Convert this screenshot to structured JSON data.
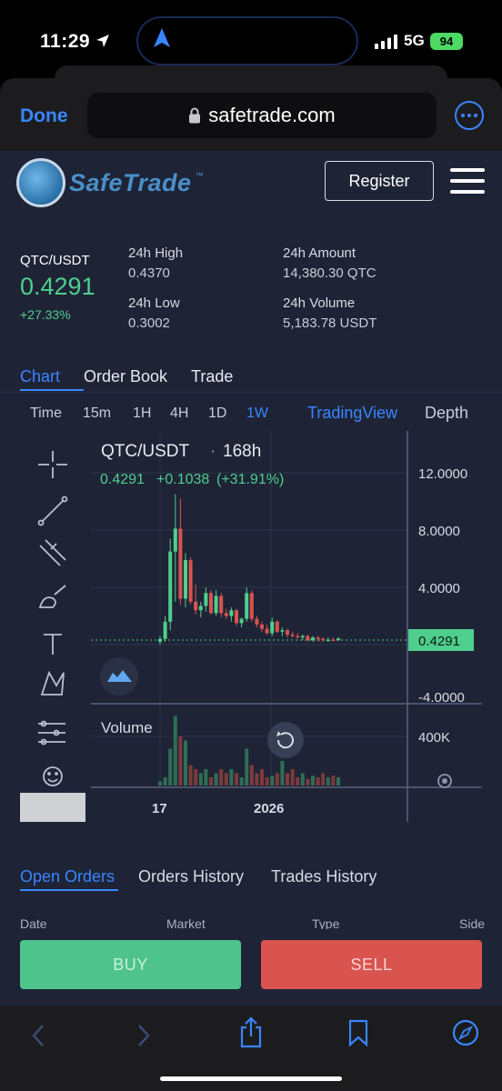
{
  "status_bar": {
    "time": "11:29",
    "network": "5G",
    "battery": "94"
  },
  "browser": {
    "done_label": "Done",
    "url": "safetrade.com"
  },
  "site": {
    "brand": "SafeTrade",
    "tm": "™",
    "register_label": "Register"
  },
  "ticker": {
    "pair": "QTC/USDT",
    "price": "0.4291",
    "change": "+27.33%",
    "high_label": "24h High",
    "high_value": "0.4370",
    "low_label": "24h Low",
    "low_value": "0.3002",
    "amount_label": "24h Amount",
    "amount_value": "14,380.30 QTC",
    "volume_label": "24h Volume",
    "volume_value": "5,183.78 USDT"
  },
  "tabs": {
    "chart": "Chart",
    "order_book": "Order Book",
    "trade": "Trade"
  },
  "intervals": [
    "Time",
    "15m",
    "1H",
    "4H",
    "1D",
    "1W"
  ],
  "chart_modes": {
    "tradingview": "TradingView",
    "depth": "Depth"
  },
  "colors": {
    "up": "#4fce8e",
    "down": "#d9534f",
    "accent": "#3a85ff",
    "bg": "#1e2436"
  },
  "chart_data": {
    "type": "candlestick",
    "title": "QTC/USDT",
    "interval": "168h",
    "last_line": {
      "close": "0.4291",
      "change": "+0.1038",
      "change_pct": "(+31.91%)"
    },
    "price_label": "0.4291",
    "y_ticks": [
      "12.0000",
      "8.0000",
      "4.0000",
      "-4.0000"
    ],
    "ylim": [
      -4,
      14.5
    ],
    "volume_label": "Volume",
    "volume_ticks": [
      "400K"
    ],
    "x_ticks": [
      "17",
      "2026"
    ],
    "candles": [
      {
        "o": 0.2,
        "h": 0.6,
        "l": 0.0,
        "c": 0.4
      },
      {
        "o": 0.4,
        "h": 2.0,
        "l": 0.2,
        "c": 1.6
      },
      {
        "o": 1.6,
        "h": 7.4,
        "l": 1.0,
        "c": 6.5
      },
      {
        "o": 6.5,
        "h": 10.5,
        "l": 3.0,
        "c": 8.1
      },
      {
        "o": 8.1,
        "h": 10.2,
        "l": 2.8,
        "c": 3.2
      },
      {
        "o": 3.2,
        "h": 6.4,
        "l": 2.6,
        "c": 5.9
      },
      {
        "o": 5.9,
        "h": 6.1,
        "l": 2.8,
        "c": 3.0
      },
      {
        "o": 3.0,
        "h": 4.2,
        "l": 2.1,
        "c": 2.4
      },
      {
        "o": 2.4,
        "h": 3.0,
        "l": 1.9,
        "c": 2.7
      },
      {
        "o": 2.7,
        "h": 4.0,
        "l": 2.3,
        "c": 3.6
      },
      {
        "o": 3.6,
        "h": 3.8,
        "l": 2.1,
        "c": 2.2
      },
      {
        "o": 2.2,
        "h": 3.8,
        "l": 2.0,
        "c": 3.4
      },
      {
        "o": 3.4,
        "h": 3.6,
        "l": 1.9,
        "c": 2.2
      },
      {
        "o": 2.2,
        "h": 2.5,
        "l": 1.8,
        "c": 2.0
      },
      {
        "o": 2.0,
        "h": 2.6,
        "l": 1.6,
        "c": 2.4
      },
      {
        "o": 2.4,
        "h": 2.5,
        "l": 1.3,
        "c": 1.5
      },
      {
        "o": 1.5,
        "h": 1.9,
        "l": 1.2,
        "c": 1.8
      },
      {
        "o": 1.8,
        "h": 4.0,
        "l": 1.6,
        "c": 3.6
      },
      {
        "o": 3.6,
        "h": 3.8,
        "l": 1.6,
        "c": 1.8
      },
      {
        "o": 1.8,
        "h": 2.0,
        "l": 1.2,
        "c": 1.4
      },
      {
        "o": 1.4,
        "h": 1.6,
        "l": 0.9,
        "c": 1.1
      },
      {
        "o": 1.1,
        "h": 1.4,
        "l": 0.7,
        "c": 0.8
      },
      {
        "o": 0.8,
        "h": 1.9,
        "l": 0.6,
        "c": 1.6
      },
      {
        "o": 1.6,
        "h": 1.7,
        "l": 0.8,
        "c": 0.9
      },
      {
        "o": 0.9,
        "h": 1.2,
        "l": 0.6,
        "c": 1.0
      },
      {
        "o": 1.0,
        "h": 1.1,
        "l": 0.5,
        "c": 0.7
      },
      {
        "o": 0.7,
        "h": 0.9,
        "l": 0.5,
        "c": 0.6
      },
      {
        "o": 0.6,
        "h": 0.8,
        "l": 0.4,
        "c": 0.5
      },
      {
        "o": 0.5,
        "h": 0.7,
        "l": 0.3,
        "c": 0.6
      },
      {
        "o": 0.6,
        "h": 0.7,
        "l": 0.2,
        "c": 0.3
      },
      {
        "o": 0.3,
        "h": 0.6,
        "l": 0.2,
        "c": 0.5
      },
      {
        "o": 0.5,
        "h": 0.6,
        "l": 0.2,
        "c": 0.4
      },
      {
        "o": 0.4,
        "h": 0.5,
        "l": 0.2,
        "c": 0.3
      },
      {
        "o": 0.3,
        "h": 0.5,
        "l": 0.2,
        "c": 0.35
      },
      {
        "o": 0.35,
        "h": 0.5,
        "l": 0.25,
        "c": 0.3
      },
      {
        "o": 0.3,
        "h": 0.5,
        "l": 0.25,
        "c": 0.43
      }
    ],
    "volumes": [
      0.05,
      0.1,
      0.45,
      0.85,
      0.6,
      0.55,
      0.25,
      0.2,
      0.15,
      0.2,
      0.1,
      0.15,
      0.2,
      0.15,
      0.2,
      0.15,
      0.1,
      0.45,
      0.25,
      0.15,
      0.2,
      0.1,
      0.12,
      0.15,
      0.3,
      0.15,
      0.2,
      0.1,
      0.15,
      0.08,
      0.12,
      0.1,
      0.15,
      0.1,
      0.12,
      0.1
    ]
  },
  "order_tabs": {
    "open": "Open Orders",
    "history": "Orders History",
    "trades": "Trades History"
  },
  "columns": {
    "date": "Date",
    "market": "Market",
    "type": "Type",
    "side": "Side"
  },
  "actions": {
    "buy": "BUY",
    "sell": "SELL"
  }
}
